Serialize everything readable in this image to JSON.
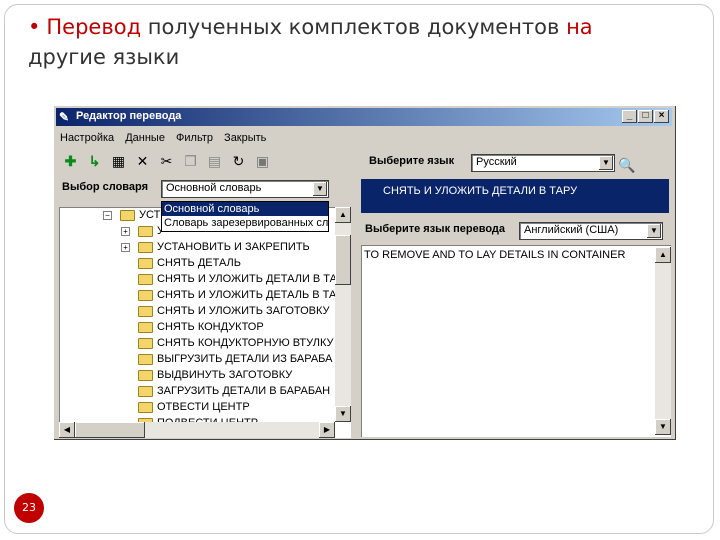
{
  "slide": {
    "bullet": "•",
    "title_part1": "Перевод",
    "title_part2": " полученных комплектов документов ",
    "title_part3": "на",
    "title_part4": "другие языки",
    "page_number": "23"
  },
  "window": {
    "title": "Редактор перевода",
    "controls": {
      "minimize": "_",
      "maximize": "□",
      "close": "×"
    }
  },
  "menu": [
    "Настройка",
    "Данные",
    "Фильтр",
    "Закрыть"
  ],
  "toolbar": {
    "icons": [
      "add-icon",
      "add-child-icon",
      "properties-icon",
      "delete-icon",
      "cut-icon",
      "copy-icon",
      "paste-icon",
      "undo-icon",
      "export-icon"
    ]
  },
  "dictionary": {
    "label": "Выбор словаря",
    "selected": "Основной словарь",
    "options": [
      "Основной словарь",
      "Словарь зарезервированных сл"
    ]
  },
  "tree": {
    "items": [
      "УСТ",
      "У",
      "УСТАНОВИТЬ И ЗАКРЕПИТЬ",
      "СНЯТЬ ДЕТАЛЬ",
      "СНЯТЬ И УЛОЖИТЬ ДЕТАЛИ В ТА",
      "СНЯТЬ И УЛОЖИТЬ ДЕТАЛЬ В ТА",
      "СНЯТЬ И УЛОЖИТЬ ЗАГОТОВКУ",
      "СНЯТЬ КОНДУКТОР",
      "СНЯТЬ КОНДУКТОРНУЮ ВТУЛКУ",
      "ВЫГРУЗИТЬ ДЕТАЛИ ИЗ БАРАБА",
      "ВЫДВИНУТЬ ЗАГОТОВКУ",
      "ЗАГРУЗИТЬ ДЕТАЛИ В БАРАБАН",
      "ОТВЕСТИ ЦЕНТР",
      "ПОДВЕСТИ ЦЕНТР"
    ]
  },
  "source_lang": {
    "label": "Выберите  язык",
    "selected": "Русский",
    "text": "СНЯТЬ И УЛОЖИТЬ ДЕТАЛИ В ТАРУ"
  },
  "target_lang": {
    "label": "Выберите язык перевода",
    "selected": "Английский (США)",
    "text": "TO REMOVE AND TO LAY DETAILS IN CONTAINER"
  }
}
